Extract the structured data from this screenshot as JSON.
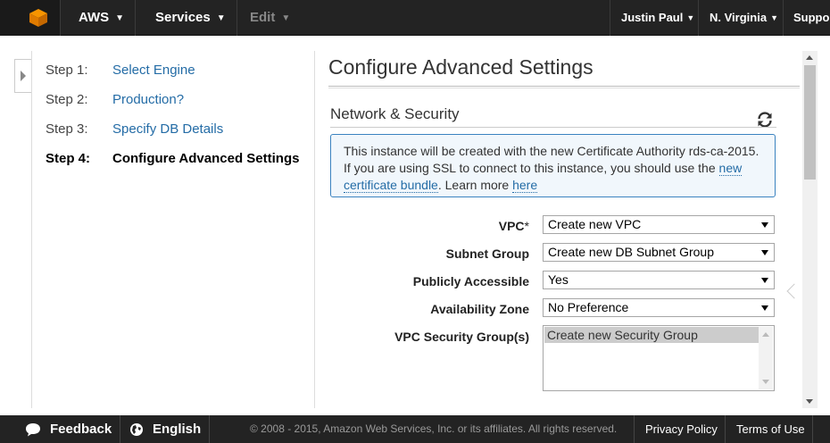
{
  "colors": {
    "topbar": "#232323",
    "link": "#246ca6",
    "info_border": "#3b83c0",
    "info_bg": "#f1f7fc",
    "aws_orange": "#f79400"
  },
  "topnav": {
    "brand": "AWS",
    "services": "Services",
    "edit": "Edit",
    "user": "Justin Paul",
    "region": "N. Virginia",
    "support": "Support"
  },
  "steps": [
    {
      "num": "Step 1:",
      "label": "Select Engine"
    },
    {
      "num": "Step 2:",
      "label": "Production?"
    },
    {
      "num": "Step 3:",
      "label": "Specify DB Details"
    },
    {
      "num": "Step 4:",
      "label": "Configure Advanced Settings"
    }
  ],
  "page_title": "Configure Advanced Settings",
  "section_title": "Network & Security",
  "info": {
    "text": "This instance will be created with the new Certificate Authority rds-ca-2015. If you are using SSL to connect to this instance, you should use the",
    "link1": "new certificate bundle",
    "middle": ". Learn more",
    "link2": "here"
  },
  "fields": {
    "vpc": {
      "label": "VPC",
      "required": "*",
      "value": "Create new VPC"
    },
    "subnet": {
      "label": "Subnet Group",
      "value": "Create new DB Subnet Group"
    },
    "public": {
      "label": "Publicly Accessible",
      "value": "Yes"
    },
    "az": {
      "label": "Availability Zone",
      "value": "No Preference"
    },
    "sg": {
      "label": "VPC Security Group(s)",
      "option": "Create new Security Group"
    }
  },
  "footer": {
    "feedback": "Feedback",
    "language": "English",
    "copyright": "© 2008 - 2015, Amazon Web Services, Inc. or its affiliates. All rights reserved.",
    "privacy": "Privacy Policy",
    "terms": "Terms of Use"
  },
  "icons": [
    "aws-cube-icon",
    "caret-down-icon",
    "expand-arrow-icon",
    "refresh-icon",
    "speech-bubble-icon",
    "globe-icon"
  ]
}
